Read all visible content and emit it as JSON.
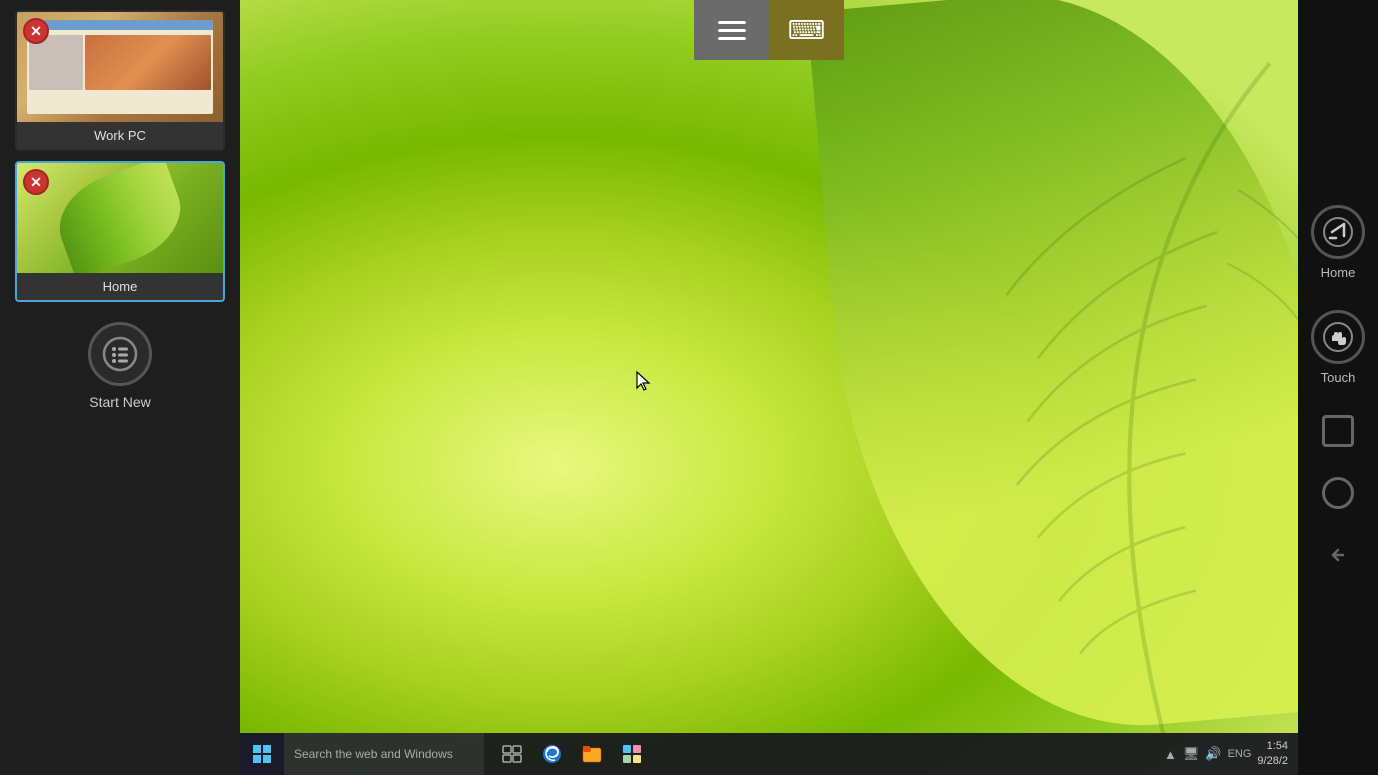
{
  "sidebar": {
    "connections": [
      {
        "id": "work-pc",
        "label": "Work PC",
        "active": false,
        "thumbnail_type": "workpc"
      },
      {
        "id": "home",
        "label": "Home",
        "active": true,
        "thumbnail_type": "home"
      }
    ],
    "start_new_label": "Start New"
  },
  "toolbar": {
    "menu_label": "menu",
    "keyboard_label": "keyboard"
  },
  "right_nav": {
    "home_label": "Home",
    "touch_label": "Touch",
    "square_label": "recent-apps",
    "circle_label": "home-nav",
    "back_label": "back"
  },
  "taskbar": {
    "start_label": "Start",
    "search_placeholder": "Search the web and Windows",
    "clock_time": "1:54",
    "clock_date": "9/28/2",
    "icons": [
      {
        "name": "task-view",
        "symbol": "⧉"
      },
      {
        "name": "edge-browser",
        "symbol": "e"
      },
      {
        "name": "file-explorer",
        "symbol": "📁"
      },
      {
        "name": "store",
        "symbol": "🛍"
      }
    ]
  }
}
